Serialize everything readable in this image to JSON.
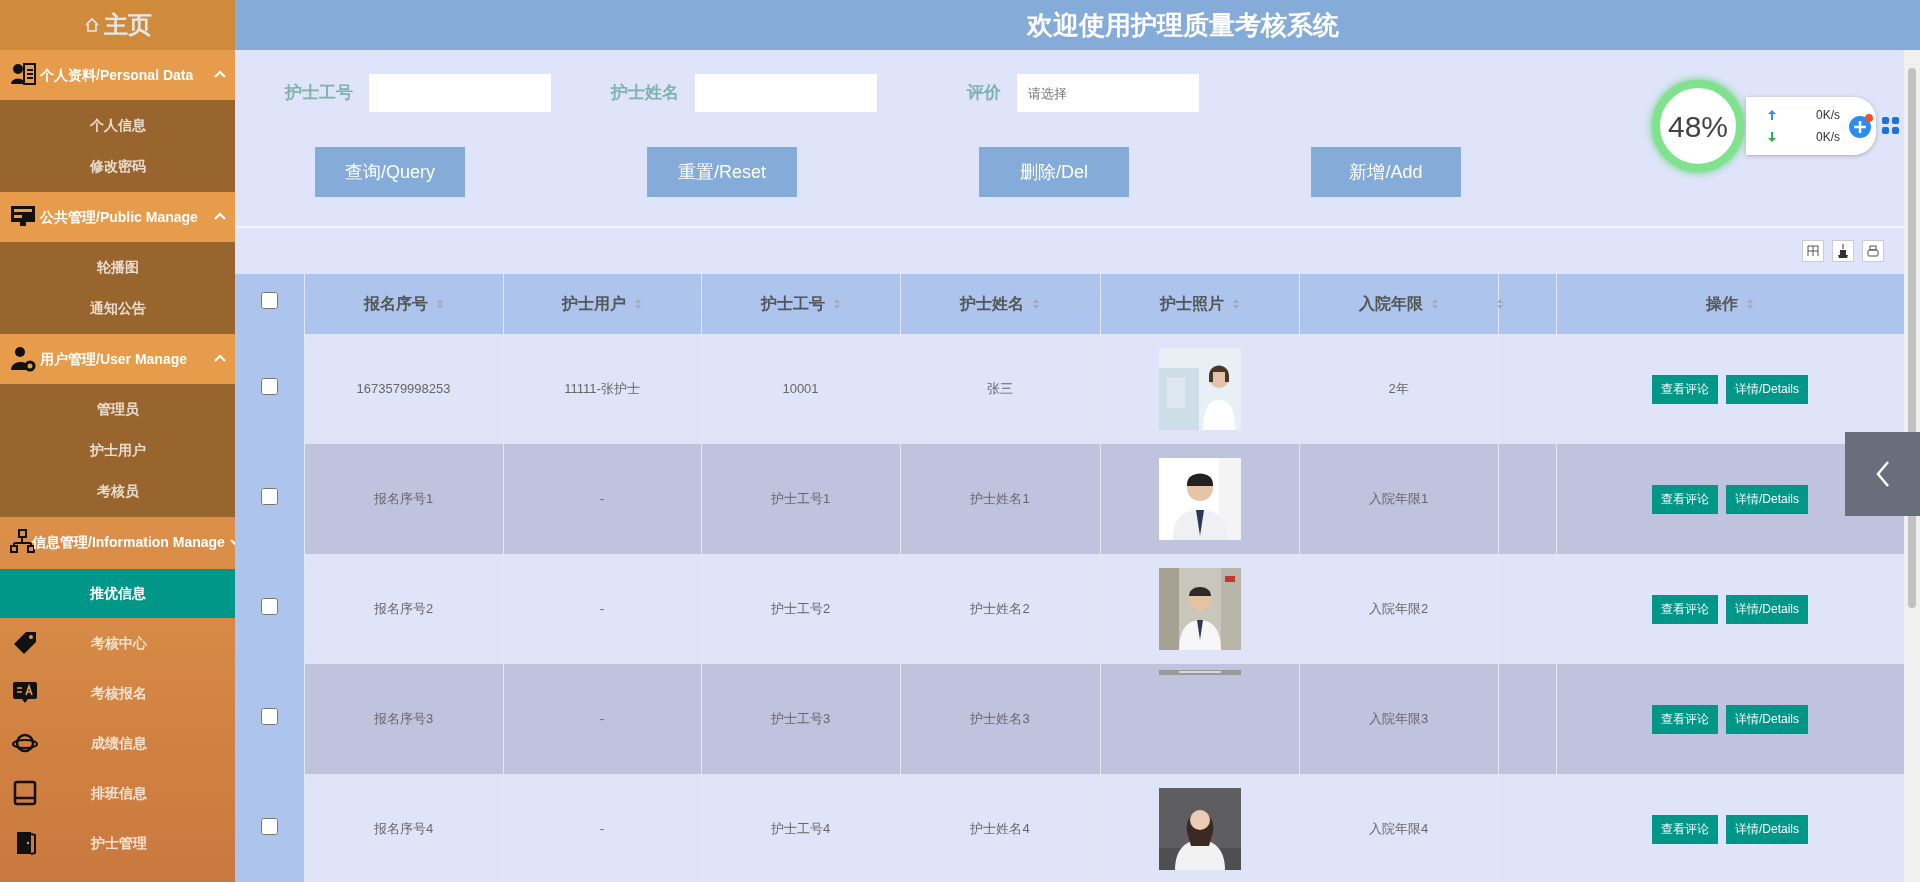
{
  "sidebar": {
    "home": "主页",
    "groups": [
      {
        "title": "个人资料/Personal Data",
        "expanded": true,
        "items": [
          {
            "label": "个人信息",
            "selected": false
          },
          {
            "label": "修改密码",
            "selected": false
          }
        ]
      },
      {
        "title": "公共管理/Public Manage",
        "expanded": true,
        "items": [
          {
            "label": "轮播图",
            "selected": false
          },
          {
            "label": "通知公告",
            "selected": false
          }
        ]
      },
      {
        "title": "用户管理/User Manage",
        "expanded": true,
        "items": [
          {
            "label": "管理员",
            "selected": false
          },
          {
            "label": "护士用户",
            "selected": false
          },
          {
            "label": "考核员",
            "selected": false
          }
        ]
      },
      {
        "title": "信息管理/Information Manage",
        "expanded": false,
        "items": [
          {
            "label": "推优信息",
            "selected": true
          }
        ]
      }
    ],
    "links": [
      {
        "label": "考核中心",
        "selected": false
      },
      {
        "label": "考核报名",
        "selected": false
      },
      {
        "label": "成绩信息",
        "selected": false
      },
      {
        "label": "排班信息",
        "selected": false
      },
      {
        "label": "护士管理",
        "selected": false
      }
    ]
  },
  "header": {
    "title": "欢迎使用护理质量考核系统"
  },
  "search": {
    "fields": [
      {
        "label": "护士工号"
      },
      {
        "label": "护士姓名"
      },
      {
        "label": "评价",
        "placeholder": "请选择"
      }
    ],
    "buttons": [
      "查询/Query",
      "重置/Reset",
      "删除/Del",
      "新增/Add"
    ]
  },
  "table": {
    "select_all": {
      "checked": false
    },
    "columns": [
      {
        "label": "报名序号",
        "sortable": true
      },
      {
        "label": "护士用户",
        "sortable": true
      },
      {
        "label": "护士工号",
        "sortable": true
      },
      {
        "label": "护士姓名",
        "sortable": true
      },
      {
        "label": "护士照片",
        "sortable": true
      },
      {
        "label": "入院年限",
        "sortable": true
      },
      {
        "sortable": true
      },
      {
        "label": "操作",
        "sortable": true
      }
    ],
    "rows": [
      {
        "checked": false,
        "cells": [
          "1673579998253",
          "11111-张护士",
          "10001",
          "张三"
        ],
        "years": "2年",
        "actions": [
          "查看评论",
          "详情/Details"
        ]
      },
      {
        "checked": false,
        "cells": [
          "报名序号1",
          "-",
          "护士工号1",
          "护士姓名1"
        ],
        "years": "入院年限1",
        "actions": [
          "查看评论",
          "详情/Details"
        ]
      },
      {
        "checked": false,
        "cells": [
          "报名序号2",
          "-",
          "护士工号2",
          "护士姓名2"
        ],
        "years": "入院年限2",
        "actions": [
          "查看评论",
          "详情/Details"
        ]
      },
      {
        "checked": false,
        "cells": [
          "报名序号3",
          "-",
          "护士工号3",
          "护士姓名3"
        ],
        "years": "入院年限3",
        "actions": [
          "查看评论",
          "详情/Details"
        ]
      },
      {
        "checked": false,
        "cells": [
          "报名序号4",
          "-",
          "护士工号4",
          "护士姓名4"
        ],
        "years": "入院年限4",
        "actions": [
          "查看评论",
          "详情/Details"
        ]
      }
    ]
  },
  "speed_widget": {
    "percent": "48%",
    "upload": "0K/s",
    "download": "0K/s"
  }
}
